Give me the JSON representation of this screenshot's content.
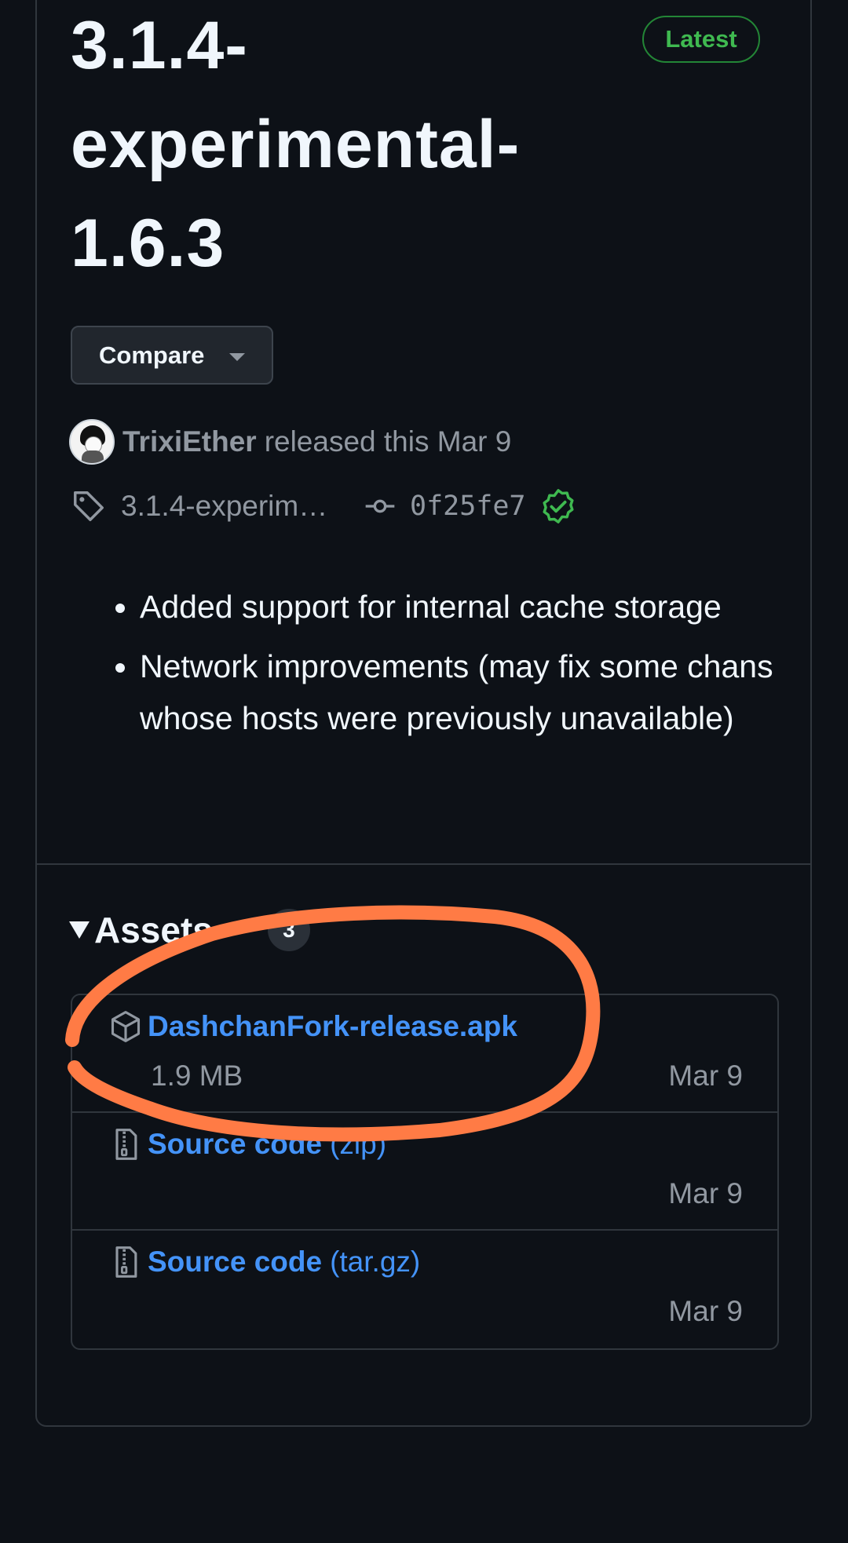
{
  "release": {
    "title": "3.1.4-experimental-1.6.3",
    "latest_badge": "Latest",
    "compare_label": "Compare",
    "author": "TrixiEther",
    "released_text": "released this Mar 9",
    "tag": "3.1.4-experim…",
    "commit": "0f25fe7",
    "notes": [
      "Added support for internal cache storage",
      "Network improvements (may fix some chans whose hosts were previously unavailable)"
    ]
  },
  "assets": {
    "title": "Assets",
    "count": "3",
    "items": [
      {
        "name": "DashchanFork-release.apk",
        "suffix": "",
        "size": "1.9 MB",
        "date": "Mar 9",
        "icon": "package-icon"
      },
      {
        "name": "Source code",
        "suffix": "(zip)",
        "size": "",
        "date": "Mar 9",
        "icon": "file-zip-icon"
      },
      {
        "name": "Source code",
        "suffix": "(tar.gz)",
        "size": "",
        "date": "Mar 9",
        "icon": "file-zip-icon"
      }
    ]
  },
  "colors": {
    "background": "#0d1117",
    "link": "#4493f8",
    "success": "#3fb950",
    "annotation": "#ff7b45"
  }
}
